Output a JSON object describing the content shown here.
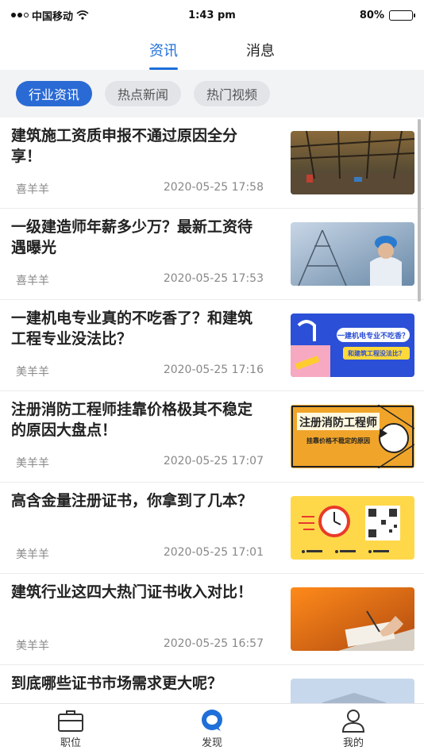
{
  "status_bar": {
    "carrier": "中国移动",
    "time": "1:43 pm",
    "battery": "80%",
    "battery_level": 0.8
  },
  "top_tabs": [
    {
      "label": "资讯",
      "active": true
    },
    {
      "label": "消息",
      "active": false
    }
  ],
  "categories": [
    {
      "label": "行业资讯",
      "active": true
    },
    {
      "label": "热点新闻",
      "active": false
    },
    {
      "label": "热门视频",
      "active": false
    }
  ],
  "articles": [
    {
      "title": "建筑施工资质申报不通过原因全分享！",
      "author": "喜羊羊",
      "date": "2020-05-25 17:58",
      "thumb": "steel-structure"
    },
    {
      "title": "一级建造师年薪多少万？最新工资待遇曝光",
      "author": "喜羊羊",
      "date": "2020-05-25 17:53",
      "thumb": "engineer-helmet"
    },
    {
      "title": "一建机电专业真的不吃香了？和建筑工程专业没法比？",
      "author": "美羊羊",
      "date": "2020-05-25 17:16",
      "thumb_text": [
        "一建机电专业不吃香？",
        "和建筑工程没法比？"
      ]
    },
    {
      "title": "注册消防工程师挂靠价格极其不稳定的原因大盘点！",
      "author": "美羊羊",
      "date": "2020-05-25 17:07",
      "thumb_text": [
        "注册消防工程师",
        "挂靠价格不稳定的原因"
      ]
    },
    {
      "title": "高含金量注册证书，你拿到了几本？",
      "author": "美羊羊",
      "date": "2020-05-25 17:01",
      "thumb": "alarm-clock-qr"
    },
    {
      "title": "建筑行业这四大热门证书收入对比！",
      "author": "美羊羊",
      "date": "2020-05-25 16:57",
      "thumb": "hand-writing"
    },
    {
      "title": "到底哪些证书市场需求更大呢？",
      "author": "",
      "date": "",
      "thumb": "building"
    }
  ],
  "bottom_nav": [
    {
      "label": "职位",
      "icon": "briefcase-icon",
      "active": false
    },
    {
      "label": "发现",
      "icon": "discover-icon",
      "active": true
    },
    {
      "label": "我的",
      "icon": "user-icon",
      "active": false
    }
  ],
  "colors": {
    "accent": "#1e6fd9",
    "chip_active": "#2a6ad4"
  }
}
